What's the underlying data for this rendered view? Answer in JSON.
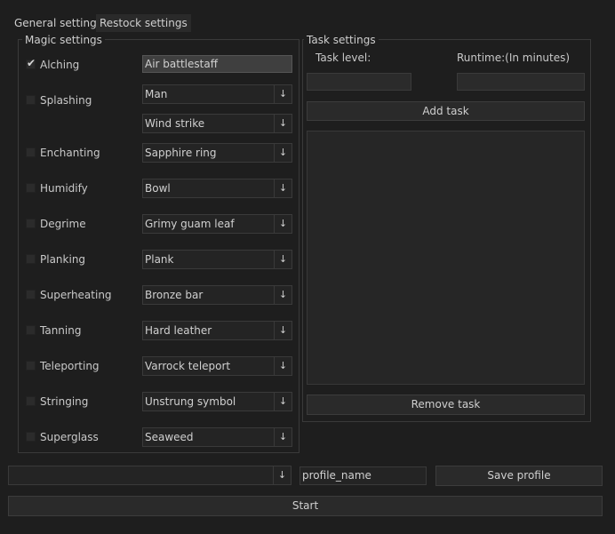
{
  "tabs": [
    "General settings",
    "Restock settings"
  ],
  "magic": {
    "title": "Magic settings",
    "rows": [
      {
        "label": "Alching",
        "checked": true,
        "value": "Air battlestaff",
        "kind": "text"
      },
      {
        "label": "Splashing",
        "checked": false,
        "value": "Man",
        "value2": "Wind strike",
        "kind": "combo"
      },
      {
        "label": "Enchanting",
        "checked": false,
        "value": "Sapphire ring",
        "kind": "combo"
      },
      {
        "label": "Humidify",
        "checked": false,
        "value": "Bowl",
        "kind": "combo"
      },
      {
        "label": "Degrime",
        "checked": false,
        "value": "Grimy guam leaf",
        "kind": "combo"
      },
      {
        "label": "Planking",
        "checked": false,
        "value": "Plank",
        "kind": "combo"
      },
      {
        "label": "Superheating",
        "checked": false,
        "value": "Bronze bar",
        "kind": "combo"
      },
      {
        "label": "Tanning",
        "checked": false,
        "value": "Hard leather",
        "kind": "combo"
      },
      {
        "label": "Teleporting",
        "checked": false,
        "value": "Varrock teleport",
        "kind": "combo"
      },
      {
        "label": "Stringing",
        "checked": false,
        "value": "Unstrung symbol",
        "kind": "combo"
      },
      {
        "label": "Superglass",
        "checked": false,
        "value": "Seaweed",
        "kind": "combo"
      }
    ]
  },
  "task": {
    "title": "Task settings",
    "level_label": "Task level:",
    "runtime_label": "Runtime:(In minutes)",
    "level_value": "",
    "runtime_value": "",
    "add_button": "Add task",
    "remove_button": "Remove task"
  },
  "footer": {
    "profile_select_value": "",
    "profile_name": "profile_name",
    "save_button": "Save profile",
    "start_button": "Start"
  },
  "icons": {
    "dropdown": "↓",
    "check": "✔"
  }
}
